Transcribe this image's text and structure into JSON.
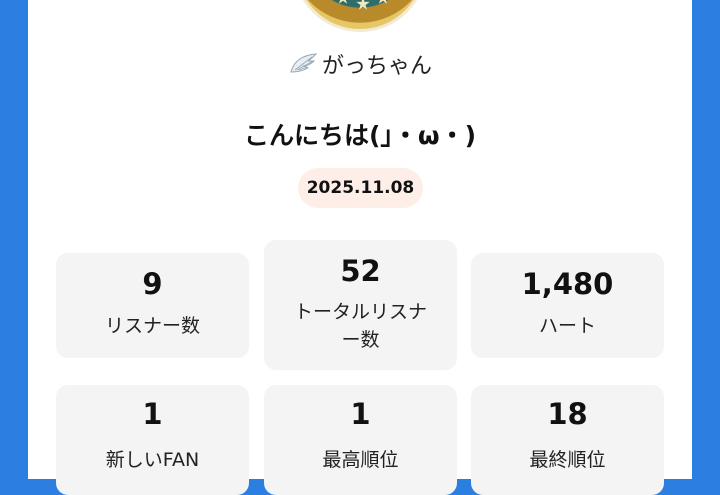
{
  "profile": {
    "name": "がっちゃん",
    "greeting": "こんにちは(」・ω・)",
    "date": "2025.11.08"
  },
  "stats": [
    {
      "value": "9",
      "label": "リスナー数"
    },
    {
      "value": "52",
      "label_line1": "トータルリスナ",
      "label_line2": "ー数"
    },
    {
      "value": "1,480",
      "label": "ハート"
    },
    {
      "value": "1",
      "label": "新しいFAN"
    },
    {
      "value": "1",
      "label": "最高順位"
    },
    {
      "value": "18",
      "label": "最終順位"
    }
  ]
}
